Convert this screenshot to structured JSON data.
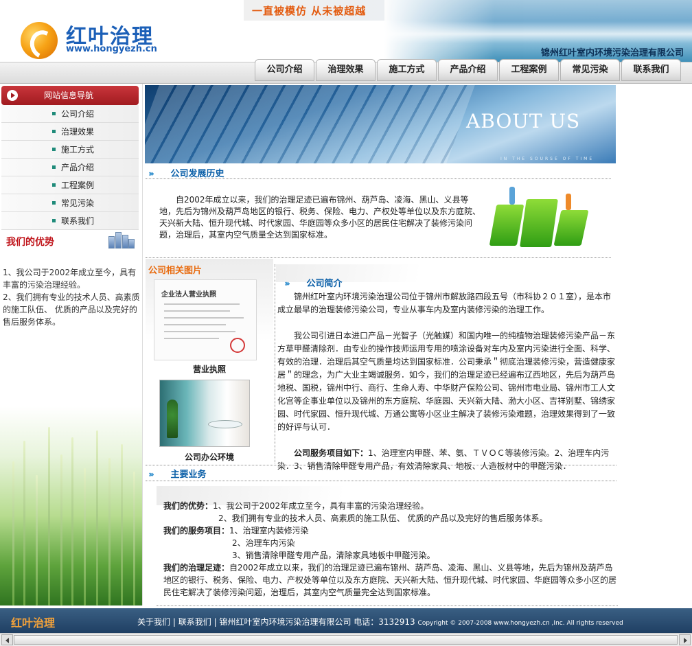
{
  "header": {
    "slogan": "一直被模仿  从未被超越",
    "logo_title": "红叶治理",
    "logo_url": "www.hongyezh.cn",
    "company_name": "锦州红叶室内环境污染治理有限公司"
  },
  "nav": {
    "items": [
      "公司介绍",
      "治理效果",
      "施工方式",
      "产品介绍",
      "工程案例",
      "常见污染",
      "联系我们"
    ]
  },
  "sidebar": {
    "header": "网站信息导航",
    "items": [
      "公司介绍",
      "治理效果",
      "施工方式",
      "产品介绍",
      "工程案例",
      "常见污染",
      "联系我们"
    ],
    "advantage_title": "我们的优势",
    "advantage_lines": [
      "1、我公司于2002年成立至今，具有丰富的污染治理经验。",
      "2、我们拥有专业的技术人员、高素质的施工队伍、 优质的产品以及完好的售后服务体系。"
    ]
  },
  "banner": {
    "title": "ABOUT US",
    "subtitle": "IN THE SOURSE OF TIME"
  },
  "history": {
    "heading": "公司发展历史",
    "text": "自2002年成立以来，我们的治理足迹已遍布锦州、葫芦岛、凌海、黑山、义县等地，先后为锦州及葫芦岛地区的银行、税务、保险、电力、产权处等单位以及东方庭院、天兴新大陆、恒升现代城、时代家园、华庭园等众多小区的居民住宅解决了装修污染问题，治理后，其室内空气质量全达到国家标准。"
  },
  "photos": {
    "title": "公司相关图片",
    "license_doc_title": "企业法人营业执照",
    "caption_license": "营业执照",
    "caption_office": "公司办公环境"
  },
  "intro": {
    "heading": "公司简介",
    "p1": "锦州红叶室内环境污染治理公司位于锦州市解放路四段五号（市科协２０１室），是本市成立最早的治理装修污染公司，专业从事车内及室内装修污染的治理工作。",
    "p2": "我公司引进日本进口产品－光智子（光触媒）和国内唯一的纯植物治理装修污染产品－东方草甲醛清除剂．由专业的操作技师运用专用的喷涂设备对车内及室内污染进行全面、科学、有效的治理．治理后其空气质量均达到国家标准．公司秉承＂彻底治理装修污染，营造健康家居＂的理念，为广大业主竭诚服务．如今，我们的治理足迹已经遍布辽西地区，先后为葫芦岛地税、国税，锦州中行、商行、生命人寿、中华财产保险公司、锦州市电业局、锦州市工人文化宫等企事业单位以及锦州的东方庭院、华庭园、天兴新大陆、渤大小区、吉祥别墅、锦绣家园、时代家园、恒升现代城、万通公寓等小区业主解决了装修污染难题，治理效果得到了一致的好评与认可．",
    "p3_label": "公司服务项目如下：",
    "p3_text": "1、治理室内甲醛、苯、氨、ＴＶＯＣ等装修污染。2、治理车内污染．3、销售清除甲醛专用产品，有效清除家具、地板、人造板材中的甲醛污染．"
  },
  "business": {
    "heading": "主要业务",
    "adv_label": "我们的优势：",
    "adv_1": "1、我公司于2002年成立至今，具有丰富的污染治理经验。",
    "adv_2": "2、我们拥有专业的技术人员、高素质的施工队伍、 优质的产品以及完好的售后服务体系。",
    "svc_label": "我们的服务项目：",
    "svc_1": "1、治理室内装修污染",
    "svc_2": "2、治理车内污染",
    "svc_3": "3、销售清除甲醛专用产品，清除家具地板中甲醛污染。",
    "track_label": "我们的治理足迹：",
    "track_text": "自2002年成立以来，我们的治理足迹已遍布锦州、葫芦岛、凌海、黑山、义县等地，先后为锦州及葫芦岛地区的银行、税务、保险、电力、产权处等单位以及东方庭院、天兴新大陆、恒升现代城、时代家园、华庭园等众多小区的居民住宅解决了装修污染问题，治理后，其室内空气质量完全达到国家标准。"
  },
  "footer": {
    "logo": "红叶治理",
    "about_link": "关于我们",
    "sep": "|",
    "contact_link": "联系我们",
    "company": "锦州红叶室内环境污染治理有限公司 电话：3132913",
    "copyright": "Copyright © 2007-2008 www.hongyezh.cn ,Inc. All rights reserved"
  },
  "icons": {
    "section_arrow": "double-chevron-right-icon",
    "nav_head": "play-circle-icon"
  }
}
